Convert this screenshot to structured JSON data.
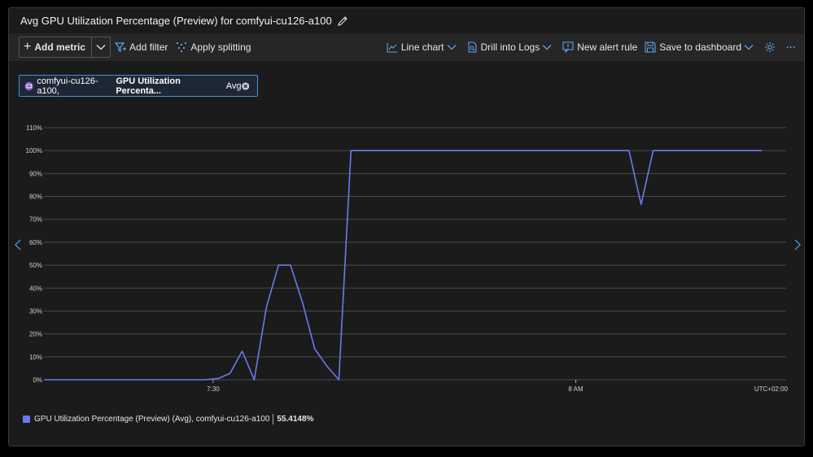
{
  "title": "Avg GPU Utilization Percentage (Preview) for comfyui-cu126-a100",
  "toolbar": {
    "add_metric": "Add metric",
    "add_filter": "Add filter",
    "apply_splitting": "Apply splitting",
    "line_chart": "Line chart",
    "drill_into_logs": "Drill into Logs",
    "new_alert_rule": "New alert rule",
    "save_to_dashboard": "Save to dashboard",
    "more": "···"
  },
  "metric_pill": {
    "resource": "comfyui-cu126-a100,",
    "metric": "GPU Utilization Percenta...",
    "aggregation": "Avg"
  },
  "legend": {
    "label": "GPU Utilization Percentage (Preview) (Avg), comfyui-cu126-a100",
    "value": "55.4148%"
  },
  "colors": {
    "series": "#6b79f0",
    "accent": "#4a90d9"
  },
  "chart_data": {
    "type": "line",
    "title": "Avg GPU Utilization Percentage (Preview) for comfyui-cu126-a100",
    "xlabel": "",
    "ylabel": "",
    "timezone_label": "UTC+02:00",
    "x_ticks": [
      {
        "label": "7:30",
        "minute": 30
      },
      {
        "label": "8 AM",
        "minute": 60
      }
    ],
    "x_range_minutes": [
      16,
      77.4
    ],
    "y_ticks": [
      "0%",
      "10%",
      "20%",
      "30%",
      "40%",
      "50%",
      "60%",
      "70%",
      "80%",
      "90%",
      "100%",
      "110%"
    ],
    "ylim": [
      0,
      110
    ],
    "grid": true,
    "series": [
      {
        "name": "GPU Utilization Percentage (Preview) (Avg), comfyui-cu126-a100",
        "x": [
          16,
          29.3,
          30.4,
          31.4,
          32.4,
          33.4,
          34.4,
          35.4,
          36.4,
          37.4,
          38.4,
          39.4,
          40.4,
          41.4,
          42.4,
          43.4,
          64.4,
          65.4,
          66.4,
          75.4
        ],
        "values": [
          0,
          0,
          0.5,
          2.8,
          12.5,
          0,
          31.5,
          50,
          50,
          33.5,
          13.5,
          6,
          0,
          100,
          100,
          100,
          100,
          76.5,
          100,
          100
        ]
      }
    ]
  }
}
